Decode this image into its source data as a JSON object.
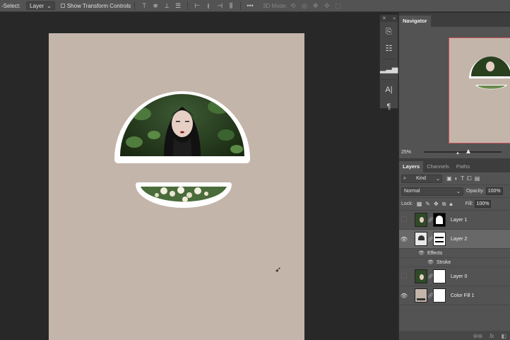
{
  "options_bar": {
    "select_label": "-Select:",
    "select_value": "Layer",
    "show_transform_label": "Show Transform Controls",
    "mode_label": "3D Mode:",
    "more_label": "•••",
    "align_icons": [
      "align-top-icon",
      "align-vcenter-icon",
      "align-bottom-icon",
      "align-left-icon",
      "distribute-icon",
      "align-right-icon",
      "distribute-v-icon",
      "distribute-h-icon"
    ],
    "mode_icons": [
      "orbit-icon",
      "roll-icon",
      "pan-3d-icon",
      "slide-icon",
      "scale-3d-icon"
    ]
  },
  "dock": {
    "collapse_label": "«",
    "close_label": "✕",
    "tools": [
      "history-icon",
      "adjustments-icon",
      "histogram-icon",
      "character-icon",
      "paragraph-icon"
    ]
  },
  "navigator": {
    "tab_label": "Navigator",
    "zoom": "25%"
  },
  "layers_panel": {
    "tabs": [
      "Layers",
      "Channels",
      "Paths"
    ],
    "filter_value": "Kind",
    "filter_icons": [
      "pixel-filter-icon",
      "adjustment-filter-icon",
      "type-filter-icon",
      "shape-filter-icon",
      "smart-filter-icon"
    ],
    "blend_mode": "Normal",
    "opacity_label": "Opacity:",
    "opacity_value": "100%",
    "lock_label": "Lock:",
    "fill_label": "Fill:",
    "fill_value": "100%",
    "layers": [
      {
        "name": "Layer 1",
        "visible": false,
        "selected": false
      },
      {
        "name": "Layer 2",
        "visible": true,
        "selected": true
      },
      {
        "name": "Layer 0",
        "visible": false,
        "selected": false
      },
      {
        "name": "Color Fill 1",
        "visible": true,
        "selected": false
      }
    ],
    "effects_label": "Effects",
    "stroke_label": "Stroke",
    "bottom_icons": [
      "link-layers-icon",
      "fx-icon"
    ]
  },
  "colors": {
    "canvas": "#c4b5aa",
    "workspace": "#282828",
    "panel": "#535353",
    "foliage": "#2e4a2a"
  }
}
